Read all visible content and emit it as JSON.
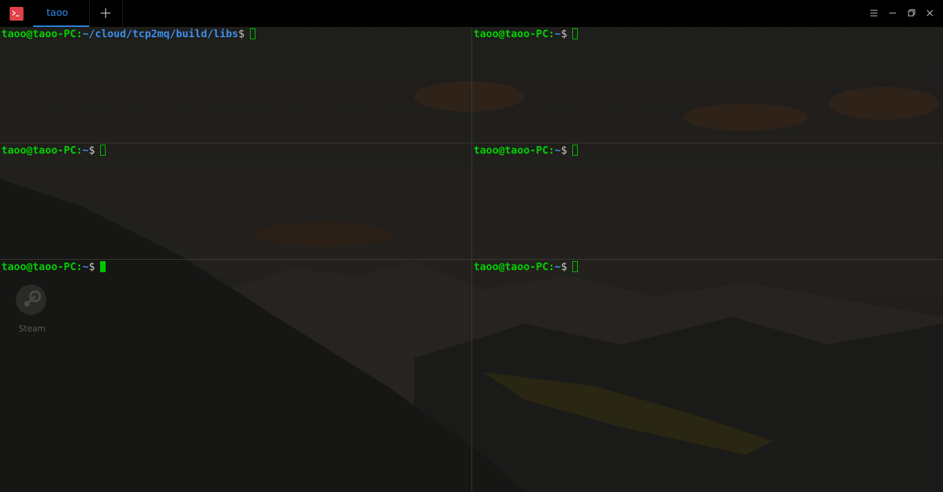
{
  "window": {
    "tab_label": "taoo",
    "accent_color": "#2d8cf0"
  },
  "panes": [
    {
      "user_host": "taoo@taoo-PC",
      "path": "~/cloud/tcp2mq/build/libs",
      "prompt": "$",
      "active": false
    },
    {
      "user_host": "taoo@taoo-PC",
      "path": "~",
      "prompt": "$",
      "active": false
    },
    {
      "user_host": "taoo@taoo-PC",
      "path": "~",
      "prompt": "$",
      "active": false
    },
    {
      "user_host": "taoo@taoo-PC",
      "path": "~",
      "prompt": "$",
      "active": false
    },
    {
      "user_host": "taoo@taoo-PC",
      "path": "~",
      "prompt": "$",
      "active": true
    },
    {
      "user_host": "taoo@taoo-PC",
      "path": "~",
      "prompt": "$",
      "active": false
    }
  ],
  "desktop": {
    "steam_label": "Steam"
  },
  "colors": {
    "prompt_green": "#00d000",
    "path_blue": "#3b8eea"
  }
}
